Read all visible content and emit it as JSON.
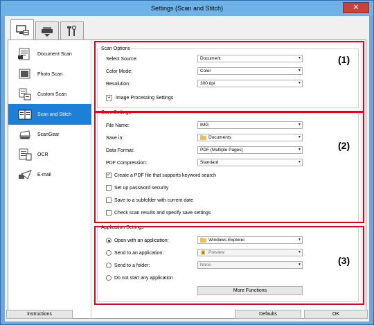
{
  "window": {
    "title": "Settings (Scan and Stitch)",
    "close": "✕"
  },
  "tabs": [
    {
      "name": "scan-from-computer"
    },
    {
      "name": "scan-from-operation-panel"
    },
    {
      "name": "general-settings"
    }
  ],
  "sidebar": {
    "items": [
      {
        "label": "Document Scan"
      },
      {
        "label": "Photo Scan"
      },
      {
        "label": "Custom Scan"
      },
      {
        "label": "Scan and Stitch"
      },
      {
        "label": "ScanGear"
      },
      {
        "label": "OCR"
      },
      {
        "label": "E-mail"
      }
    ],
    "selected_index": 3
  },
  "scan_options": {
    "title": "Scan Options",
    "source_label": "Select Source:",
    "source_value": "Document",
    "color_label": "Color Mode:",
    "color_value": "Color",
    "resolution_label": "Resolution:",
    "resolution_value": "300 dpi",
    "image_processing_label": "Image Processing Settings",
    "expand_symbol": "+"
  },
  "save_settings": {
    "title": "Save Settings",
    "filename_label": "File Name:",
    "filename_value": "IMG",
    "savein_label": "Save in:",
    "savein_value": "Documents",
    "format_label": "Data Format:",
    "format_value": "PDF (Multiple Pages)",
    "compression_label": "PDF Compression:",
    "compression_value": "Standard",
    "cb_keyword": "Create a PDF file that supports keyword search",
    "cb_keyword_checked": true,
    "cb_password": "Set up password security",
    "cb_subfolder": "Save to a subfolder with current date",
    "cb_check": "Check scan results and specify save settings",
    "check_mark": "✓"
  },
  "app_settings": {
    "title": "Application Settings",
    "open_label": "Open with an application:",
    "open_value": "Windows Explorer",
    "send_app_label": "Send to an application:",
    "send_app_value": "Preview",
    "send_folder_label": "Send to a folder:",
    "send_folder_value": "None",
    "no_app_label": "Do not start any application",
    "more_functions": "More Functions"
  },
  "callouts": [
    "(1)",
    "(2)",
    "(3)"
  ],
  "footer": {
    "instructions": "Instructions",
    "defaults": "Defaults",
    "ok": "OK"
  },
  "colors": {
    "accent": "#1e7fd8",
    "highlight_border": "#e3001b",
    "titlebar": "#6fb3e6",
    "close": "#c9423a"
  }
}
